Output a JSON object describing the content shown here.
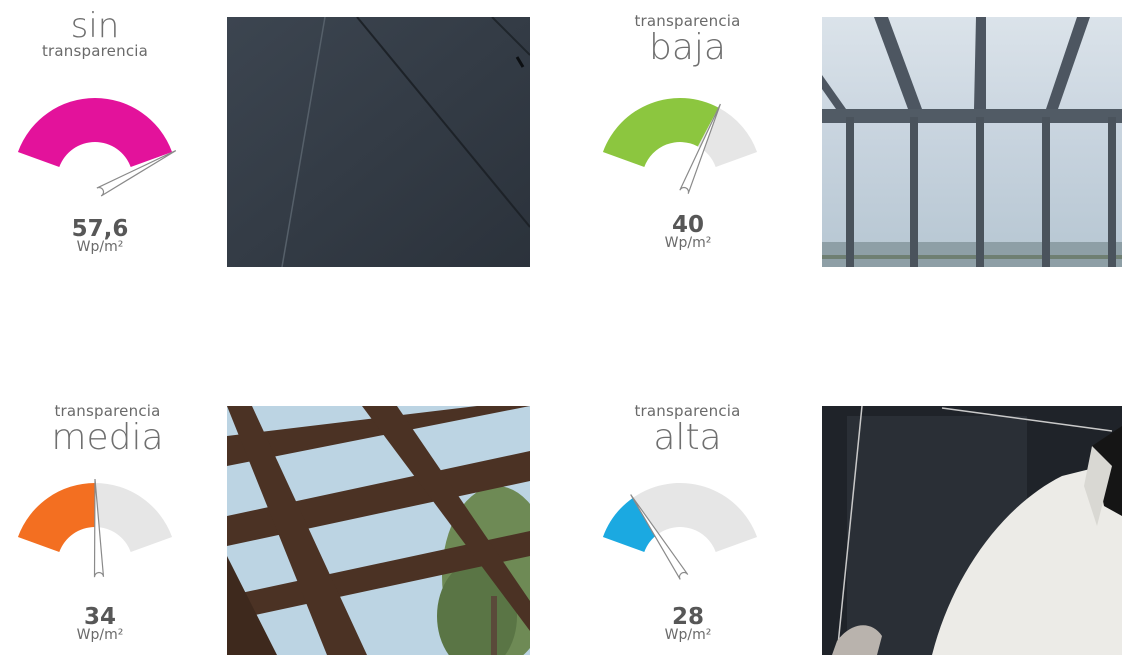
{
  "panels": [
    {
      "top_line": "sin",
      "bottom_line": "transparencia",
      "order": "big-first",
      "value": "57,6",
      "unit": "Wp/m²",
      "fraction": 1.0,
      "color": "#e3129b"
    },
    {
      "top_line": "transparencia",
      "bottom_line": "baja",
      "order": "small-first",
      "value": "40",
      "unit": "Wp/m²",
      "fraction": 0.7,
      "color": "#8cc63f"
    },
    {
      "top_line": "transparencia",
      "bottom_line": "media",
      "order": "small-first",
      "value": "34",
      "unit": "Wp/m²",
      "fraction": 0.5,
      "color": "#f36f21"
    },
    {
      "top_line": "transparencia",
      "bottom_line": "alta",
      "order": "small-first",
      "value": "28",
      "unit": "Wp/m²",
      "fraction": 0.25,
      "color": "#1ba9e1"
    }
  ],
  "gauge_track_color": "#e6e6e6"
}
